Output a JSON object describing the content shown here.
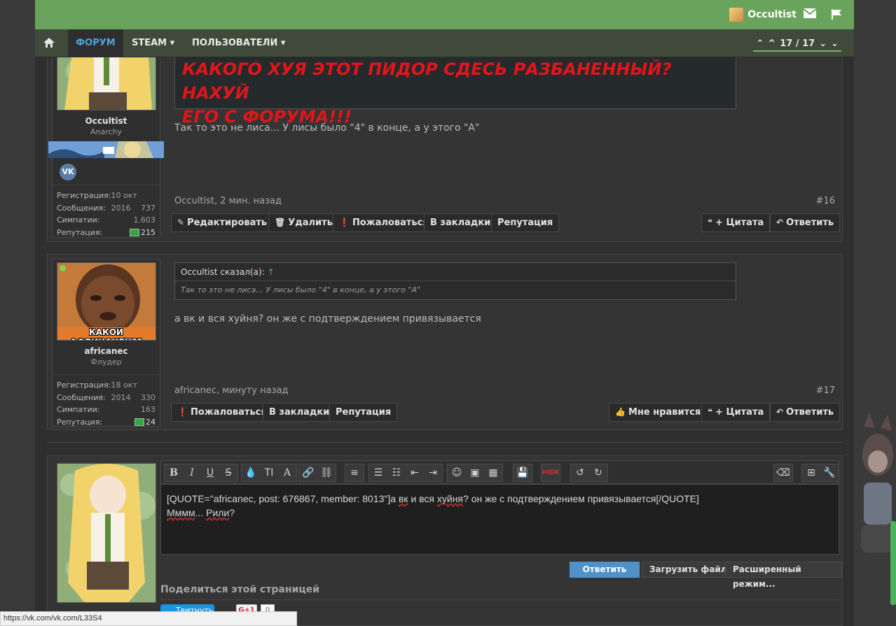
{
  "topbar": {
    "username": "Occultist",
    "icons": [
      "envelope-icon",
      "flag-icon"
    ]
  },
  "nav": {
    "items": [
      {
        "label": "ФОРУМ",
        "active": true
      },
      {
        "label": "STEAM ▾",
        "active": false
      },
      {
        "label": "ПОЛЬЗОВАТЕЛИ ▾",
        "active": false
      }
    ],
    "pager": "17 / 17"
  },
  "posts": [
    {
      "author": "Occultist",
      "title": "Anarchy",
      "stats": [
        {
          "label": "Регистрация:",
          "value": "10 окт 2016"
        },
        {
          "label": "Сообщения:",
          "value": "737"
        },
        {
          "label": "Симпатии:",
          "value": "1.603"
        },
        {
          "label": "Репутация:",
          "value": "215"
        }
      ],
      "quote_lines": [
        "КАКОГО ХУЯ ЭТОТ ПИДОР СДЕСЬ РАЗБАНЕННЫЙ? НАХУЙ",
        "ЕГО С ФОРУМА!!!"
      ],
      "message": "Так то это не лиса... У лисы было \"4\" в конце, а у этого \"А\"",
      "meta": "Occultist, 2 мин. назад",
      "number": "#16",
      "buttons_left": [
        "Редактировать",
        "Удалить",
        "Пожаловаться",
        "В закладки",
        "Репутация"
      ],
      "buttons_right": [
        "+ Цитата",
        "Ответить"
      ]
    },
    {
      "author": "africanec",
      "title": "Флудер",
      "avatar_caption": "КАКОЙ АФРИКАНЕЦ??",
      "stats": [
        {
          "label": "Регистрация:",
          "value": "18 окт 2014"
        },
        {
          "label": "Сообщения:",
          "value": "330"
        },
        {
          "label": "Симпатии:",
          "value": "163"
        },
        {
          "label": "Репутация:",
          "value": "24"
        }
      ],
      "quote_head": "Occultist сказал(а):",
      "quote_arrow": "↑",
      "quote_body": "Так то это не лиса... У лисы было \"4\" в конце, а у этого \"А\"",
      "message": "а вк и вся хуйня? он же с подтверждением привязывается",
      "meta": "africanec, минуту назад",
      "number": "#17",
      "buttons_left": [
        "Пожаловаться",
        "В закладки",
        "Репутация"
      ],
      "buttons_right": [
        "Мне нравится",
        "+ Цитата",
        "Ответить"
      ]
    }
  ],
  "editor": {
    "line1_a": "[QUOTE=\"africanec, post: 676867, member: 8013\"]",
    "line1_b": "а ",
    "line1_c": "вк",
    "line1_d": " и вся ",
    "line1_e": "хуйня",
    "line1_f": "? он же с подтверждением привязывается[/QUOTE]",
    "line2_a": "Мммм",
    "line2_b": "... ",
    "line2_c": "Рили",
    "line2_d": "?",
    "buttons": [
      "Ответить",
      "Загрузить файл",
      "Расширенный режим..."
    ],
    "share_title": "Поделиться этой страницей",
    "tweet": "Твитнуть",
    "gplus": "G+1",
    "gcount": "0"
  },
  "statusbar": "https://vk.com/vk.com/L33S4"
}
